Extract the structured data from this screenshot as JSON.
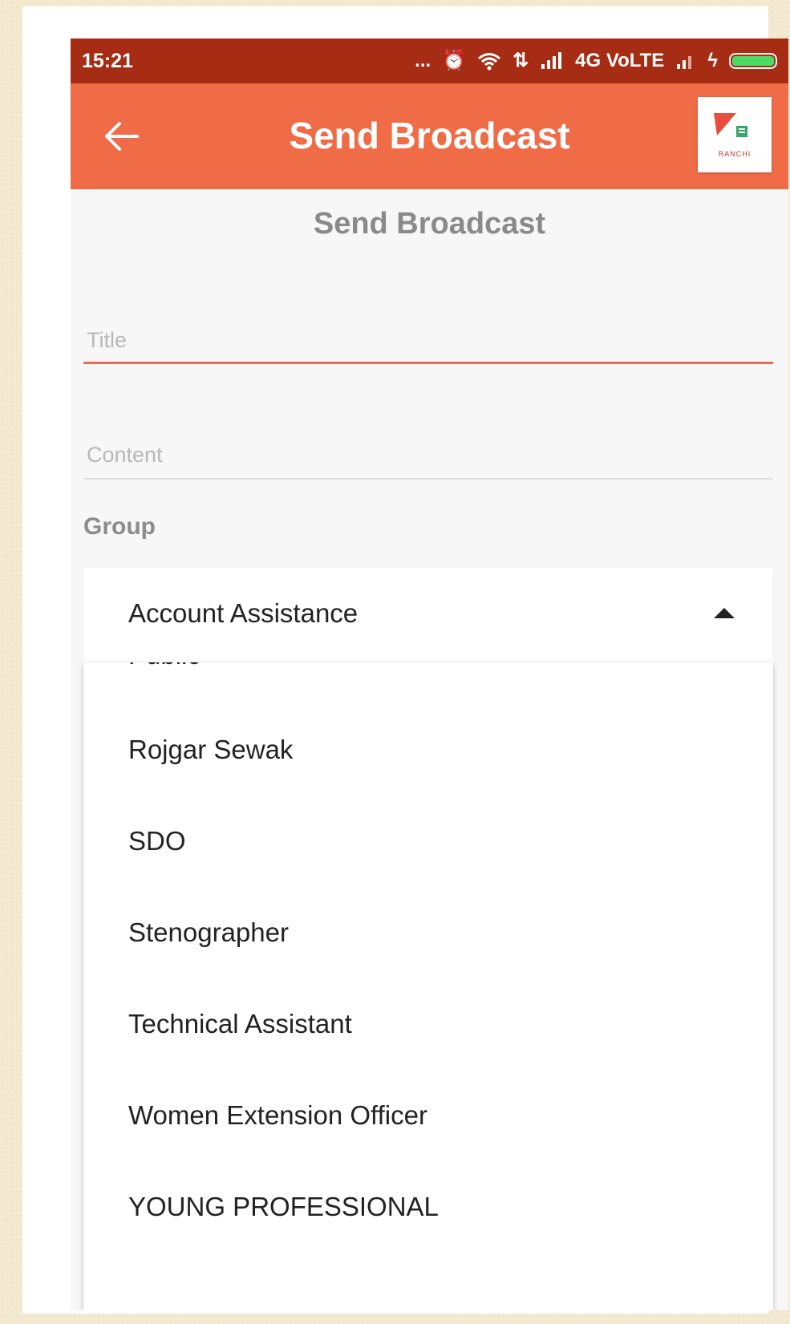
{
  "status_bar": {
    "time": "15:21",
    "dots": "...",
    "network": "4G VoLTE",
    "battery_level": 1.0
  },
  "app_bar": {
    "title": "Send Broadcast",
    "logo_text": "RANCHI"
  },
  "form": {
    "subtitle": "Send Broadcast",
    "title_placeholder": "Title",
    "title_value": "",
    "content_placeholder": "Content",
    "content_value": "",
    "group_label": "Group",
    "group_selected": "Account Assistance"
  },
  "dropdown": {
    "items": [
      "Public",
      "Rojgar Sewak",
      "SDO",
      "Stenographer",
      "Technical Assistant",
      "Women Extension Officer",
      "YOUNG PROFESSIONAL"
    ]
  },
  "colors": {
    "status_bar": "#a72c14",
    "app_bar": "#f06c47",
    "accent_underline": "#e96a56"
  }
}
